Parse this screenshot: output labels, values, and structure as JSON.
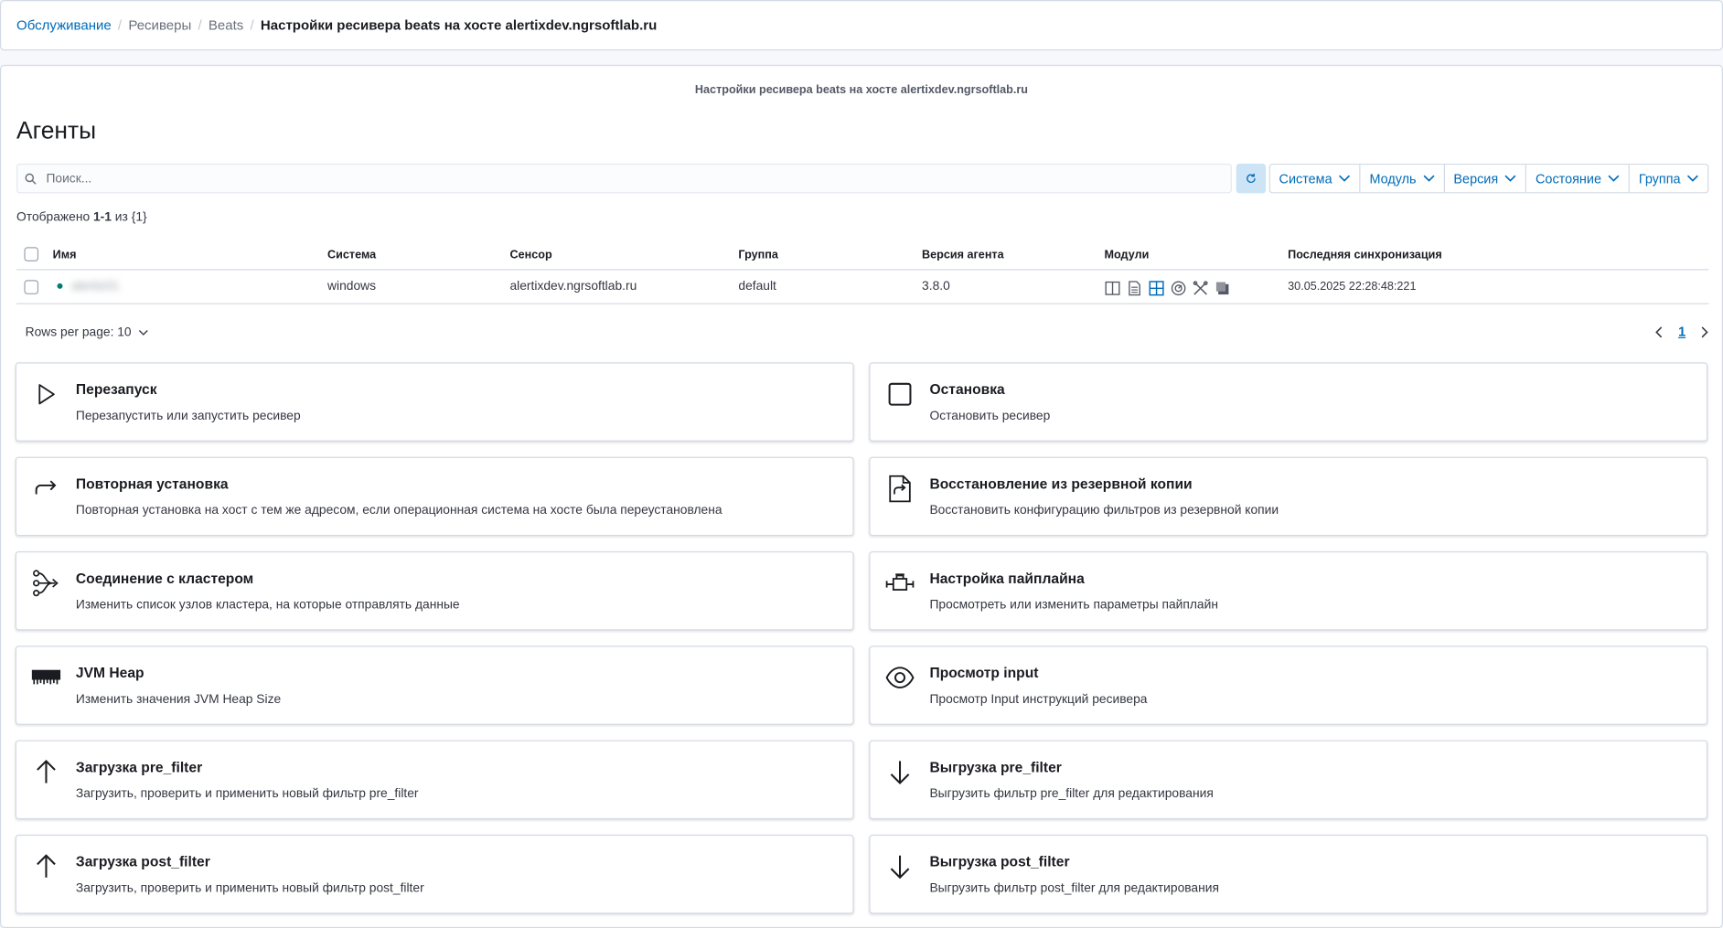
{
  "breadcrumbs": [
    "Обслуживание",
    "Ресиверы",
    "Beats",
    "Настройки ресивера beats на хосте alertixdev.ngrsoftlab.ru"
  ],
  "panel_subtitle": "Настройки ресивера beats на хосте alertixdev.ngrsoftlab.ru",
  "page_title": "Агенты",
  "search": {
    "placeholder": "Поиск..."
  },
  "filters": [
    "Система",
    "Модуль",
    "Версия",
    "Состояние",
    "Группа"
  ],
  "results": {
    "prefix": "Отображено ",
    "range": "1-1",
    "suffix": " из {1}"
  },
  "table": {
    "columns": [
      "Имя",
      "Система",
      "Сенсор",
      "Группа",
      "Версия агента",
      "Модули",
      "Последняя синхронизация"
    ],
    "rows": [
      {
        "name": "alertix01",
        "system": "windows",
        "sensor": "alertixdev.ngrsoftlab.ru",
        "group": "default",
        "version": "3.8.0",
        "modules": [
          "columns-icon",
          "document-icon",
          "grid-icon",
          "gauge-icon",
          "tools-icon",
          "copy-icon"
        ],
        "last_sync": "30.05.2025 22:28:48:221"
      }
    ]
  },
  "pagination": {
    "rows_per_page": "Rows per page: 10",
    "current_page": "1"
  },
  "colors": {
    "accent": "#006bb8",
    "status_online": "#017d73",
    "refresh_bg": "#cce4f5"
  },
  "actions": [
    {
      "icon": "play-icon",
      "title": "Перезапуск",
      "desc": "Перезапустить или запустить ресивер"
    },
    {
      "icon": "stop-icon",
      "title": "Остановка",
      "desc": "Остановить ресивер"
    },
    {
      "icon": "reinstall-icon",
      "title": "Повторная установка",
      "desc": "Повторная установка на хост с тем же адресом, если операционная система на хосте была переустановлена"
    },
    {
      "icon": "restore-icon",
      "title": "Восстановление из резервной копии",
      "desc": "Восстановить конфигурацию фильтров из резервной копии"
    },
    {
      "icon": "cluster-icon",
      "title": "Соединение с кластером",
      "desc": "Изменить список узлов кластера, на которые отправлять данные"
    },
    {
      "icon": "pipeline-icon",
      "title": "Настройка пайплайна",
      "desc": "Просмотреть или изменить параметры пайплайн"
    },
    {
      "icon": "memory-icon",
      "title": "JVM Heap",
      "desc": "Изменить значения JVM Heap Size"
    },
    {
      "icon": "eye-icon",
      "title": "Просмотр input",
      "desc": "Просмотр Input инструкций ресивера"
    },
    {
      "icon": "upload-icon",
      "title": "Загрузка pre_filter",
      "desc": "Загрузить, проверить и применить новый фильтр pre_filter"
    },
    {
      "icon": "download-icon",
      "title": "Выгрузка pre_filter",
      "desc": "Выгрузить фильтр pre_filter для редактирования"
    },
    {
      "icon": "upload-icon",
      "title": "Загрузка post_filter",
      "desc": "Загрузить, проверить и применить новый фильтр post_filter"
    },
    {
      "icon": "download-icon",
      "title": "Выгрузка post_filter",
      "desc": "Выгрузить фильтр post_filter для редактирования"
    }
  ]
}
